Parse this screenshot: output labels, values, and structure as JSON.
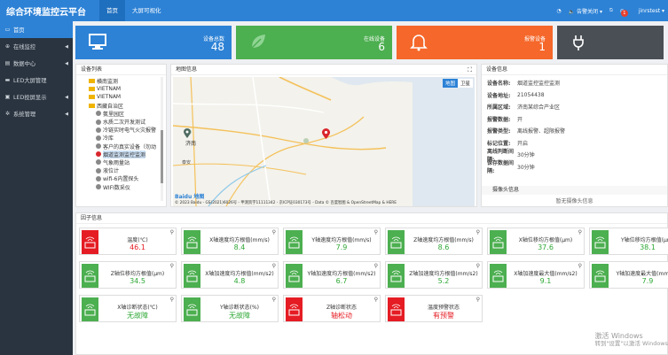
{
  "app": {
    "title": "综合环境监控云平台"
  },
  "topnav": [
    {
      "label": "首页"
    },
    {
      "label": "大屏可视化"
    }
  ],
  "topbar": {
    "alarm_off": "告警关闭",
    "notif_count": "1",
    "user": "jinrstest"
  },
  "sidebar": [
    {
      "label": "首页",
      "icon": "home"
    },
    {
      "label": "在线监控",
      "icon": "globe"
    },
    {
      "label": "数据中心",
      "icon": "folder"
    },
    {
      "label": "LED大屏管理",
      "icon": "monitor"
    },
    {
      "label": "LED投屏显示",
      "icon": "cast"
    },
    {
      "label": "系统管理",
      "icon": "gear"
    }
  ],
  "stats": [
    {
      "label": "设备总数",
      "value": "48",
      "color": "#2d82d6"
    },
    {
      "label": "在线设备",
      "value": "6",
      "color": "#4caf50"
    },
    {
      "label": "报警设备",
      "value": "1",
      "color": "#f5672a"
    },
    {
      "label": "",
      "value": "",
      "color": "#4a4f55"
    }
  ],
  "device_list": {
    "title": "设备列表",
    "items": [
      {
        "label": "横南监测",
        "type": "folder",
        "indent": 1
      },
      {
        "label": "VIETNAM",
        "type": "folder",
        "indent": 1
      },
      {
        "label": "VIETNAM",
        "type": "folder",
        "indent": 1
      },
      {
        "label": "西藏自治区",
        "type": "folder",
        "indent": 1
      },
      {
        "label": "氨里园区",
        "type": "device",
        "indent": 2
      },
      {
        "label": "水质二次开发测试",
        "type": "device",
        "indent": 2
      },
      {
        "label": "冷链实时电气火灾报警",
        "type": "device",
        "indent": 2
      },
      {
        "label": "冷库",
        "type": "device",
        "indent": 2
      },
      {
        "label": "客户的真实设备（勿动",
        "type": "device",
        "indent": 2
      },
      {
        "label": "烟道监测监控监测",
        "type": "device-red",
        "indent": 2,
        "selected": true
      },
      {
        "label": "气象雨量站",
        "type": "device",
        "indent": 2
      },
      {
        "label": "液位计",
        "type": "device",
        "indent": 2
      },
      {
        "label": "wifi-6内置探头",
        "type": "device",
        "indent": 2
      },
      {
        "label": "WIFI数采仪",
        "type": "device",
        "indent": 2
      }
    ]
  },
  "map": {
    "title": "地图信息",
    "layer_map": "地图",
    "layer_sat": "卫星",
    "city1": "济南",
    "city2": "泰安",
    "copyright": "© 2023 Baidu - GS(2021)6026号 - 甲测资字11111342 - 京ICP证030173号 - Data © 百度智图 & OpenStreetMap & HERE",
    "brand": "Baidu 地图"
  },
  "device_info": {
    "title": "设备信息",
    "rows": [
      {
        "k": "设备名称:",
        "v": "烟道监控监控监测"
      },
      {
        "k": "设备地址:",
        "v": "21054438"
      },
      {
        "k": "所属区域:",
        "v": "济南某综合产业区"
      },
      {
        "k": "报警数据:",
        "v": "开"
      },
      {
        "k": "报警类型:",
        "v": "离线报警、超限报警"
      },
      {
        "k": "标记位置:",
        "v": "开启"
      },
      {
        "k": "离线判断间隔:",
        "v": "30分钟"
      },
      {
        "k": "保存数据间隔:",
        "v": "30分钟"
      }
    ],
    "snapshot_header": "摄像头信息",
    "snapshot_none": "暂无摄像头信息"
  },
  "factor": {
    "title": "因子信息",
    "cards": [
      {
        "name": "温度(℃)",
        "value": "46.1",
        "alarm": true
      },
      {
        "name": "X轴速度均方根值(mm/s)",
        "value": "8.4",
        "alarm": false
      },
      {
        "name": "Y轴速度均方根值(mm/s)",
        "value": "7.9",
        "alarm": false
      },
      {
        "name": "Z轴速度均方根值(mm/s)",
        "value": "8.6",
        "alarm": false
      },
      {
        "name": "X轴位移均方根值(μm)",
        "value": "37.6",
        "alarm": false
      },
      {
        "name": "Y轴位移均方根值(μm)",
        "value": "38.1",
        "alarm": false
      },
      {
        "name": "Z轴位移均方根值(μm)",
        "value": "34.5",
        "alarm": false
      },
      {
        "name": "X轴加速度均方根值(mm/s2)",
        "value": "4.8",
        "alarm": false
      },
      {
        "name": "Y轴加速度均方根值(mm/s2)",
        "value": "6.7",
        "alarm": false
      },
      {
        "name": "Z轴加速度均方根值(mm/s2)",
        "value": "5.2",
        "alarm": false
      },
      {
        "name": "X轴加速度最大值(mm/s2)",
        "value": "9.1",
        "alarm": false
      },
      {
        "name": "Y轴加速度最大值(mm/s2)",
        "value": "7.9",
        "alarm": false
      },
      {
        "name": "X轴诊断状态(℃)",
        "value": "无故障",
        "alarm": false
      },
      {
        "name": "Y轴诊断状态(%)",
        "value": "无故障",
        "alarm": false
      },
      {
        "name": "Z轴诊断状态",
        "value": "轴松动",
        "alarm": true
      },
      {
        "name": "温度预警状态",
        "value": "有预警",
        "alarm": true
      }
    ]
  },
  "watermark": {
    "line1": "激活 Windows",
    "line2": "转到\"设置\"以激活 Windows"
  },
  "colors": {
    "primary": "#2d82d6",
    "sidebar": "#2a3440",
    "ok": "#4caf50",
    "alarm": "#e51c23",
    "ok_text": "#2fa836",
    "alarm_text": "#e51c23"
  }
}
